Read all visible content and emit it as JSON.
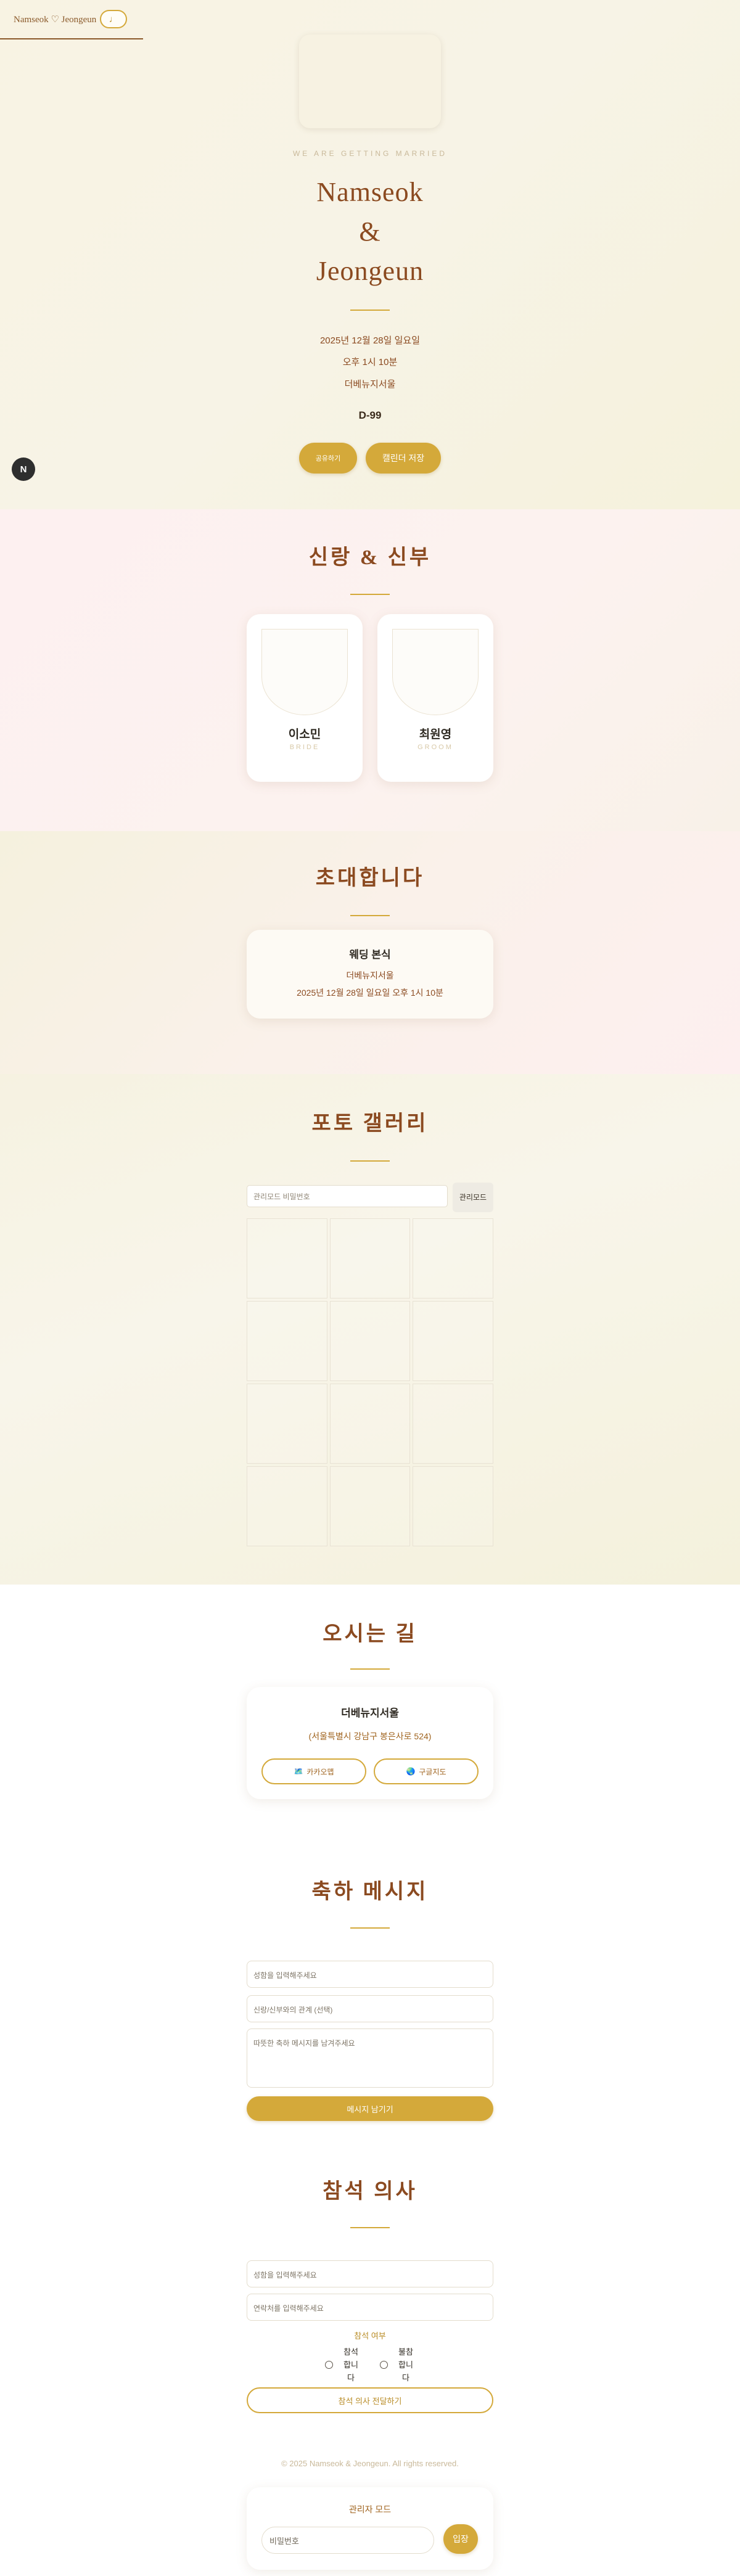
{
  "nav": {
    "brand": "Namseok ♡ Jeongeun",
    "music_icon": "♩"
  },
  "hero": {
    "subtitle": "WE ARE GETTING MARRIED",
    "name1": "Namseok",
    "amp": "&",
    "name2": "Jeongeun",
    "date": "2025년 12월 28일 일요일",
    "time": "오후 1시 10분",
    "venue": "더베뉴지서울",
    "dday": "D-99",
    "share_label": "공유하기",
    "calendar_label": "캘린더 저장"
  },
  "fab": {
    "label": "N"
  },
  "couple": {
    "title": "신랑 & 신부",
    "bride": {
      "name": "이소민",
      "role": "BRIDE"
    },
    "groom": {
      "name": "최원영",
      "role": "GROOM"
    }
  },
  "invite": {
    "title": "초대합니다",
    "card_title": "웨딩 본식",
    "venue": "더베뉴지서울",
    "datetime": "2025년 12월 28일 일요일 오후 1시 10분"
  },
  "gallery": {
    "title": "포토 갤러리",
    "password_placeholder": "관리모드 비밀번호",
    "admin_label": "관리모드",
    "cells": 12
  },
  "directions": {
    "title": "오시는 길",
    "venue": "더베뉴지서울",
    "address": "(서울특별시 강남구 봉은사로 524)",
    "kakao_label": "카카오맵",
    "google_label": "구글지도"
  },
  "messages": {
    "title": "축하 메시지",
    "name_placeholder": "성함을 입력해주세요",
    "relation_placeholder": "신랑/신부와의 관계 (선택)",
    "message_placeholder": "따뜻한 축하 메시지를 남겨주세요",
    "submit_label": "메시지 남기기"
  },
  "rsvp": {
    "title": "참석 의사",
    "name_placeholder": "성함을 입력해주세요",
    "contact_placeholder": "연락처를 입력해주세요",
    "attend_label": "참석 여부",
    "option_yes": "참석합니다",
    "option_no": "불참합니다",
    "submit_label": "참석 의사 전달하기"
  },
  "footer": {
    "copyright": "© 2025 Namseok & Jeongeun. All rights reserved.",
    "admin_title": "관리자 모드",
    "password_placeholder": "비밀번호",
    "login_label": "입장"
  },
  "colors": {
    "accent": "#d4a93a",
    "brown": "#8b4a20"
  }
}
